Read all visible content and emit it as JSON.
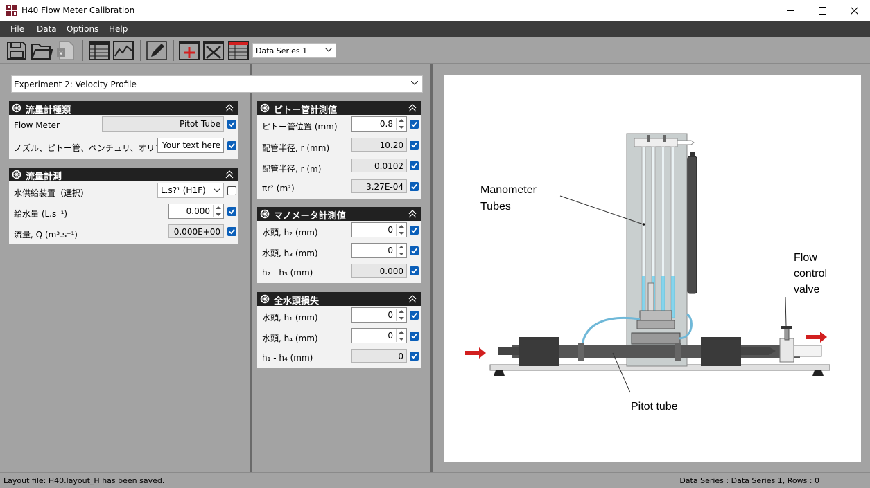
{
  "window": {
    "title": "H40 Flow Meter Calibration"
  },
  "menu": [
    "File",
    "Data",
    "Options",
    "Help"
  ],
  "toolbar": {
    "series_select": "Data Series 1"
  },
  "experiment": {
    "selected": "Experiment 2: Velocity Profile"
  },
  "panels": {
    "meter_type": {
      "title": "流量計種類",
      "rows": [
        {
          "label": "Flow Meter",
          "value": "Pitot Tube",
          "checked": true
        },
        {
          "label": "ノズル、ピトー管、ベンチュリ、オリフィス",
          "value": "Your text here",
          "checked": true
        }
      ]
    },
    "flow_measure": {
      "title": "流量計測",
      "rows": [
        {
          "label": "水供給装置（選択）",
          "value": "L.s?¹ (H1F)",
          "checked": false
        },
        {
          "label": "給水量 (L.s⁻¹)",
          "value": "0.000",
          "checked": true
        },
        {
          "label": "流量, Q (m³.s⁻¹)",
          "value": "0.000E+00",
          "checked": true
        }
      ]
    },
    "pitot": {
      "title": "ピトー管計測値",
      "rows": [
        {
          "label": "ピトー管位置 (mm)",
          "value": "0.8",
          "checked": true
        },
        {
          "label": "配管半径, r (mm)",
          "value": "10.20",
          "checked": true
        },
        {
          "label": "配管半径, r (m)",
          "value": "0.0102",
          "checked": true
        },
        {
          "label": "πr² (m²)",
          "value": "3.27E-04",
          "checked": true
        }
      ]
    },
    "manometer": {
      "title": "マノメータ計測値",
      "rows": [
        {
          "label": "水頭, h₂ (mm)",
          "value": "0",
          "checked": true
        },
        {
          "label": "水頭, h₃ (mm)",
          "value": "0",
          "checked": true
        },
        {
          "label": "h₂ - h₃ (mm)",
          "value": "0.000",
          "checked": true
        }
      ]
    },
    "head_loss": {
      "title": "全水頭損失",
      "rows": [
        {
          "label": "水頭, h₁ (mm)",
          "value": "0",
          "checked": true
        },
        {
          "label": "水頭, h₄ (mm)",
          "value": "0",
          "checked": true
        },
        {
          "label": "h₁ - h₄ (mm)",
          "value": "0",
          "checked": true
        }
      ]
    }
  },
  "diagram": {
    "label_manometer_1": "Manometer",
    "label_manometer_2": "Tubes",
    "label_flow_1": "Flow",
    "label_flow_2": "control",
    "label_flow_3": "valve",
    "label_pitot": "Pitot tube"
  },
  "status": {
    "left": "Layout file: H40.layout_H has been saved.",
    "right": "Data Series : Data Series 1,  Rows : 0"
  },
  "colors": {
    "checkbox": "#0b5fb9",
    "panel_header": "#212121",
    "menubar": "#3c3c3c",
    "arrow": "#d21f1f",
    "water": "#5bc8e8"
  }
}
